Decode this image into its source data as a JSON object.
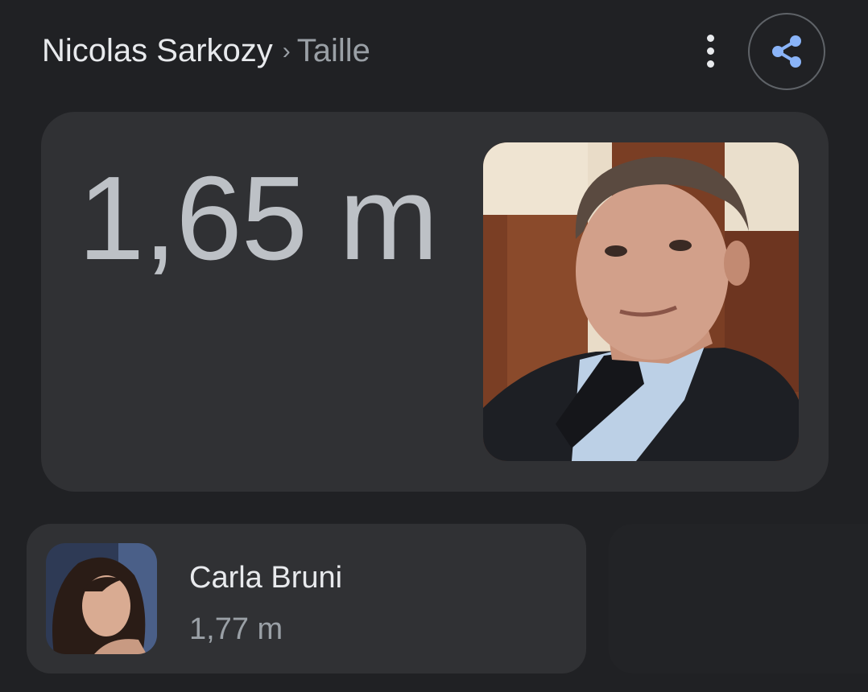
{
  "header": {
    "entity": "Nicolas Sarkozy",
    "separator": "›",
    "attribute": "Taille",
    "more_icon": "more-vert-icon",
    "share_icon": "share-icon"
  },
  "main": {
    "height": "1,65 m",
    "image": "portrait-photo"
  },
  "related": [
    {
      "name": "Carla Bruni",
      "height": "1,77 m",
      "image": "portrait-photo"
    }
  ],
  "colors": {
    "background": "#202124",
    "card": "#303134",
    "primary_text": "#e8eaed",
    "secondary_text": "#9aa0a6",
    "accent": "#8ab4f8"
  }
}
